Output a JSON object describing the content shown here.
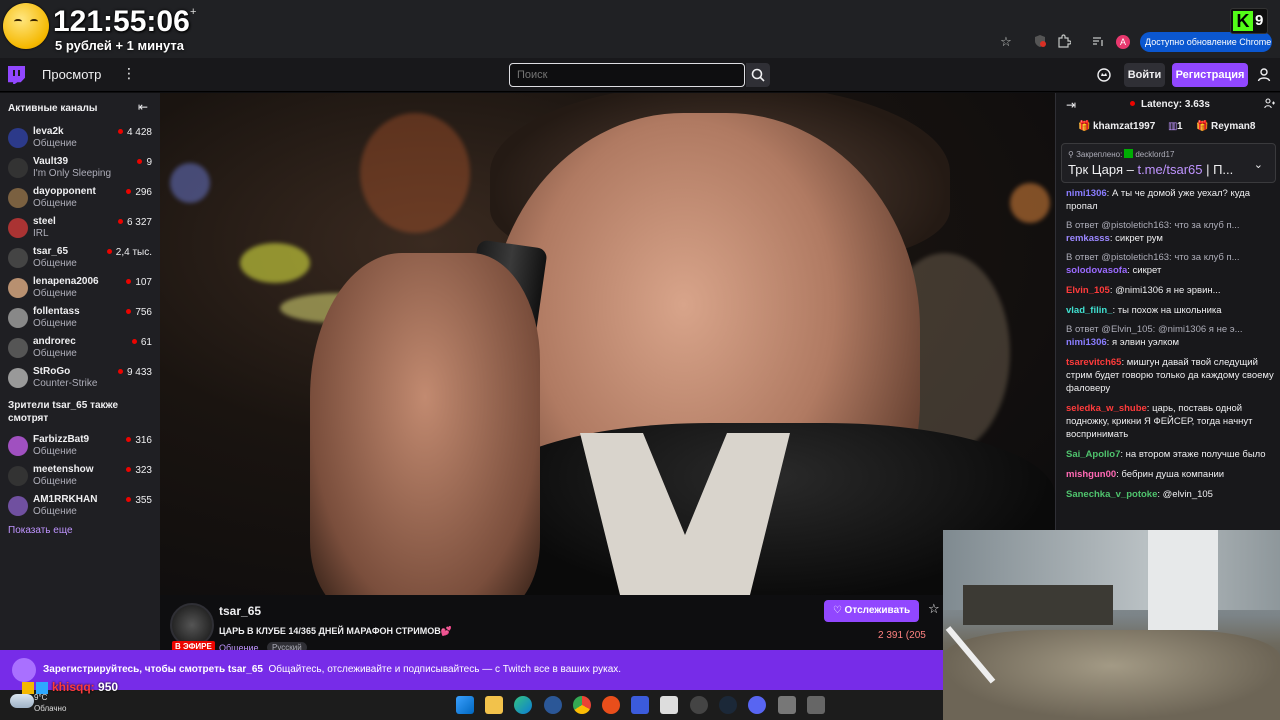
{
  "browser": {
    "timer": "121:55:06",
    "timer_plus": "+",
    "timer_sub": "5 рублей + 1 минута",
    "update_label": "Доступно обновление Chrome",
    "profile_letter": "A",
    "kick_letter": "K",
    "kick_count": "9"
  },
  "nav": {
    "browse": "Просмотр",
    "more": "⋮",
    "search_placeholder": "Поиск",
    "login": "Войти",
    "signup": "Регистрация"
  },
  "sidebar": {
    "active_header": "Активные каналы",
    "collapse": "⇤",
    "channels": [
      {
        "name": "leva2k",
        "game": "Общение",
        "viewers": "4 428"
      },
      {
        "name": "Vault39",
        "game": "I'm Only Sleeping",
        "viewers": "9"
      },
      {
        "name": "dayopponent",
        "game": "Общение",
        "viewers": "296"
      },
      {
        "name": "steel",
        "game": "IRL",
        "viewers": "6 327"
      },
      {
        "name": "tsar_65",
        "game": "Общение",
        "viewers": "2,4 тыс."
      },
      {
        "name": "lenapena2006",
        "game": "Общение",
        "viewers": "107"
      },
      {
        "name": "follentass",
        "game": "Общение",
        "viewers": "756"
      },
      {
        "name": "androrec",
        "game": "Общение",
        "viewers": "61"
      },
      {
        "name": "StRoGo",
        "game": "Counter-Strike",
        "viewers": "9 433"
      }
    ],
    "also_header": "Зрители tsar_65 также смотрят",
    "also": [
      {
        "name": "FarbizzBat9",
        "game": "Общение",
        "viewers": "316"
      },
      {
        "name": "meetenshow",
        "game": "Общение",
        "viewers": "323"
      },
      {
        "name": "AM1RRKHAN",
        "game": "Общение",
        "viewers": "355"
      }
    ],
    "show_more": "Показать еще"
  },
  "stream": {
    "channel": "tsar_65",
    "title": "ЦАРЬ В КЛУБЕ 14/365 ДНЕЙ МАРАФОН СТРИМОВ",
    "title_emoji": "💕",
    "live": "В ЭФИРЕ",
    "category": "Общение",
    "tag": "Русский",
    "follow": "♡ Отслеживать",
    "star": "☆",
    "viewers": "2 391 (205"
  },
  "chat": {
    "latency": "Latency: 3.63s",
    "gifter1": "khamzat1997",
    "gift_count": "1",
    "gifter2": "Reyman8",
    "pinned_label": "Закреплено:",
    "pinned_by": "decklord17",
    "pinned_text_a": "Трк Царя – ",
    "pinned_link": "t.me/tsar65",
    "pinned_text_b": " | П...",
    "messages": [
      {
        "reply": "",
        "user": "nimi1306",
        "color": "#8a7dff",
        "text": ": А ты че домой уже уехал? куда пропал"
      },
      {
        "reply": "В ответ @pistoletich163: что за клуб п...",
        "user": "remkasss",
        "color": "#9b87ff",
        "text": ": сикрет рум"
      },
      {
        "reply": "В ответ @pistoletich163: что за клуб п...",
        "user": "solodovasofa",
        "color": "#9b6bff",
        "text": ": сикрет"
      },
      {
        "reply": "",
        "user": "Elvin_105",
        "color": "#ff3b3b",
        "text": ": @nimi1306 я не эрвин..."
      },
      {
        "reply": "",
        "user": "vlad_filin_",
        "color": "#40e0d0",
        "text": ": ты похож на школьника"
      },
      {
        "reply": "В ответ @Elvin_105: @nimi1306 я не э...",
        "user": "nimi1306",
        "color": "#8a7dff",
        "text": ": я элвин уэлком"
      },
      {
        "reply": "",
        "user": "tsarevitch65",
        "color": "#ff3b3b",
        "text": ": мишгун давай твой следущий стрим будет говорю только да каждому своему фаловеру"
      },
      {
        "reply": "",
        "user": "seledka_w_shube",
        "color": "#ff3b3b",
        "text": ": царь, поставь одной подножку, крикни Я ФЕЙСЕР, тогда начнут воспринимать"
      },
      {
        "reply": "",
        "user": "Sai_Apollo7",
        "color": "#4fc36d",
        "text": ": на втором этаже получше было"
      },
      {
        "reply": "",
        "user": "mishgun00",
        "color": "#ff69b4",
        "text": ": бебрин душа компании"
      },
      {
        "reply": "",
        "user": "Sanechka_v_potoke",
        "color": "#4fc36d",
        "text": ": @elvin_105"
      }
    ]
  },
  "banner": {
    "title": "Зарегистрируйтесь, чтобы смотреть tsar_65",
    "subtitle": "Общайтесь, отслеживайте и подписывайтесь — с Twitch все в ваших руках."
  },
  "overlay": {
    "name": "khisqq:",
    "points": "950"
  },
  "taskbar": {
    "temp": "9°C",
    "condition": "Облачно"
  }
}
